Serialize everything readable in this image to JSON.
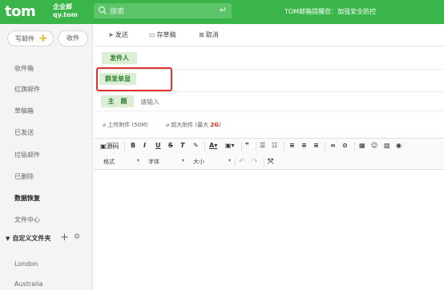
{
  "header": {
    "logo": "tom",
    "logo_sub1": "企业邮",
    "logo_sub2": "qy.tom",
    "search_placeholder": "搜索",
    "notice": "TOM邮箱提醒您：加强安全防控"
  },
  "sidebar": {
    "write_label": "写邮件",
    "receive_label": "收件",
    "items": [
      {
        "label": "收件箱"
      },
      {
        "label": "红旗邮件"
      },
      {
        "label": "草稿箱"
      },
      {
        "label": "已发送"
      },
      {
        "label": "垃圾邮件"
      },
      {
        "label": "已删除"
      },
      {
        "label": "数据恢复"
      },
      {
        "label": "文件中心"
      }
    ],
    "custom_folder_label": "自定义文件夹",
    "folders": [
      {
        "label": "London"
      },
      {
        "label": "Australia"
      }
    ]
  },
  "toolbar": {
    "send_label": "发送",
    "draft_label": "存草稿",
    "cancel_label": "取消"
  },
  "compose": {
    "sender_label": "发件人",
    "sender_value": "",
    "group_send_label": "群发单显",
    "subject_label": "主　题",
    "subject_placeholder": "请输入"
  },
  "attachments": {
    "upload_label": "上传附件 (50M)",
    "big_label": "超大附件 (最大 ",
    "big_size": "2G",
    "big_close": ")"
  },
  "editor": {
    "source_label": "源码",
    "format_label": "格式",
    "font_label": "字体",
    "size_label": "大小"
  },
  "colors": {
    "brand_green": "#39b54a",
    "highlight_red": "#e03030"
  }
}
